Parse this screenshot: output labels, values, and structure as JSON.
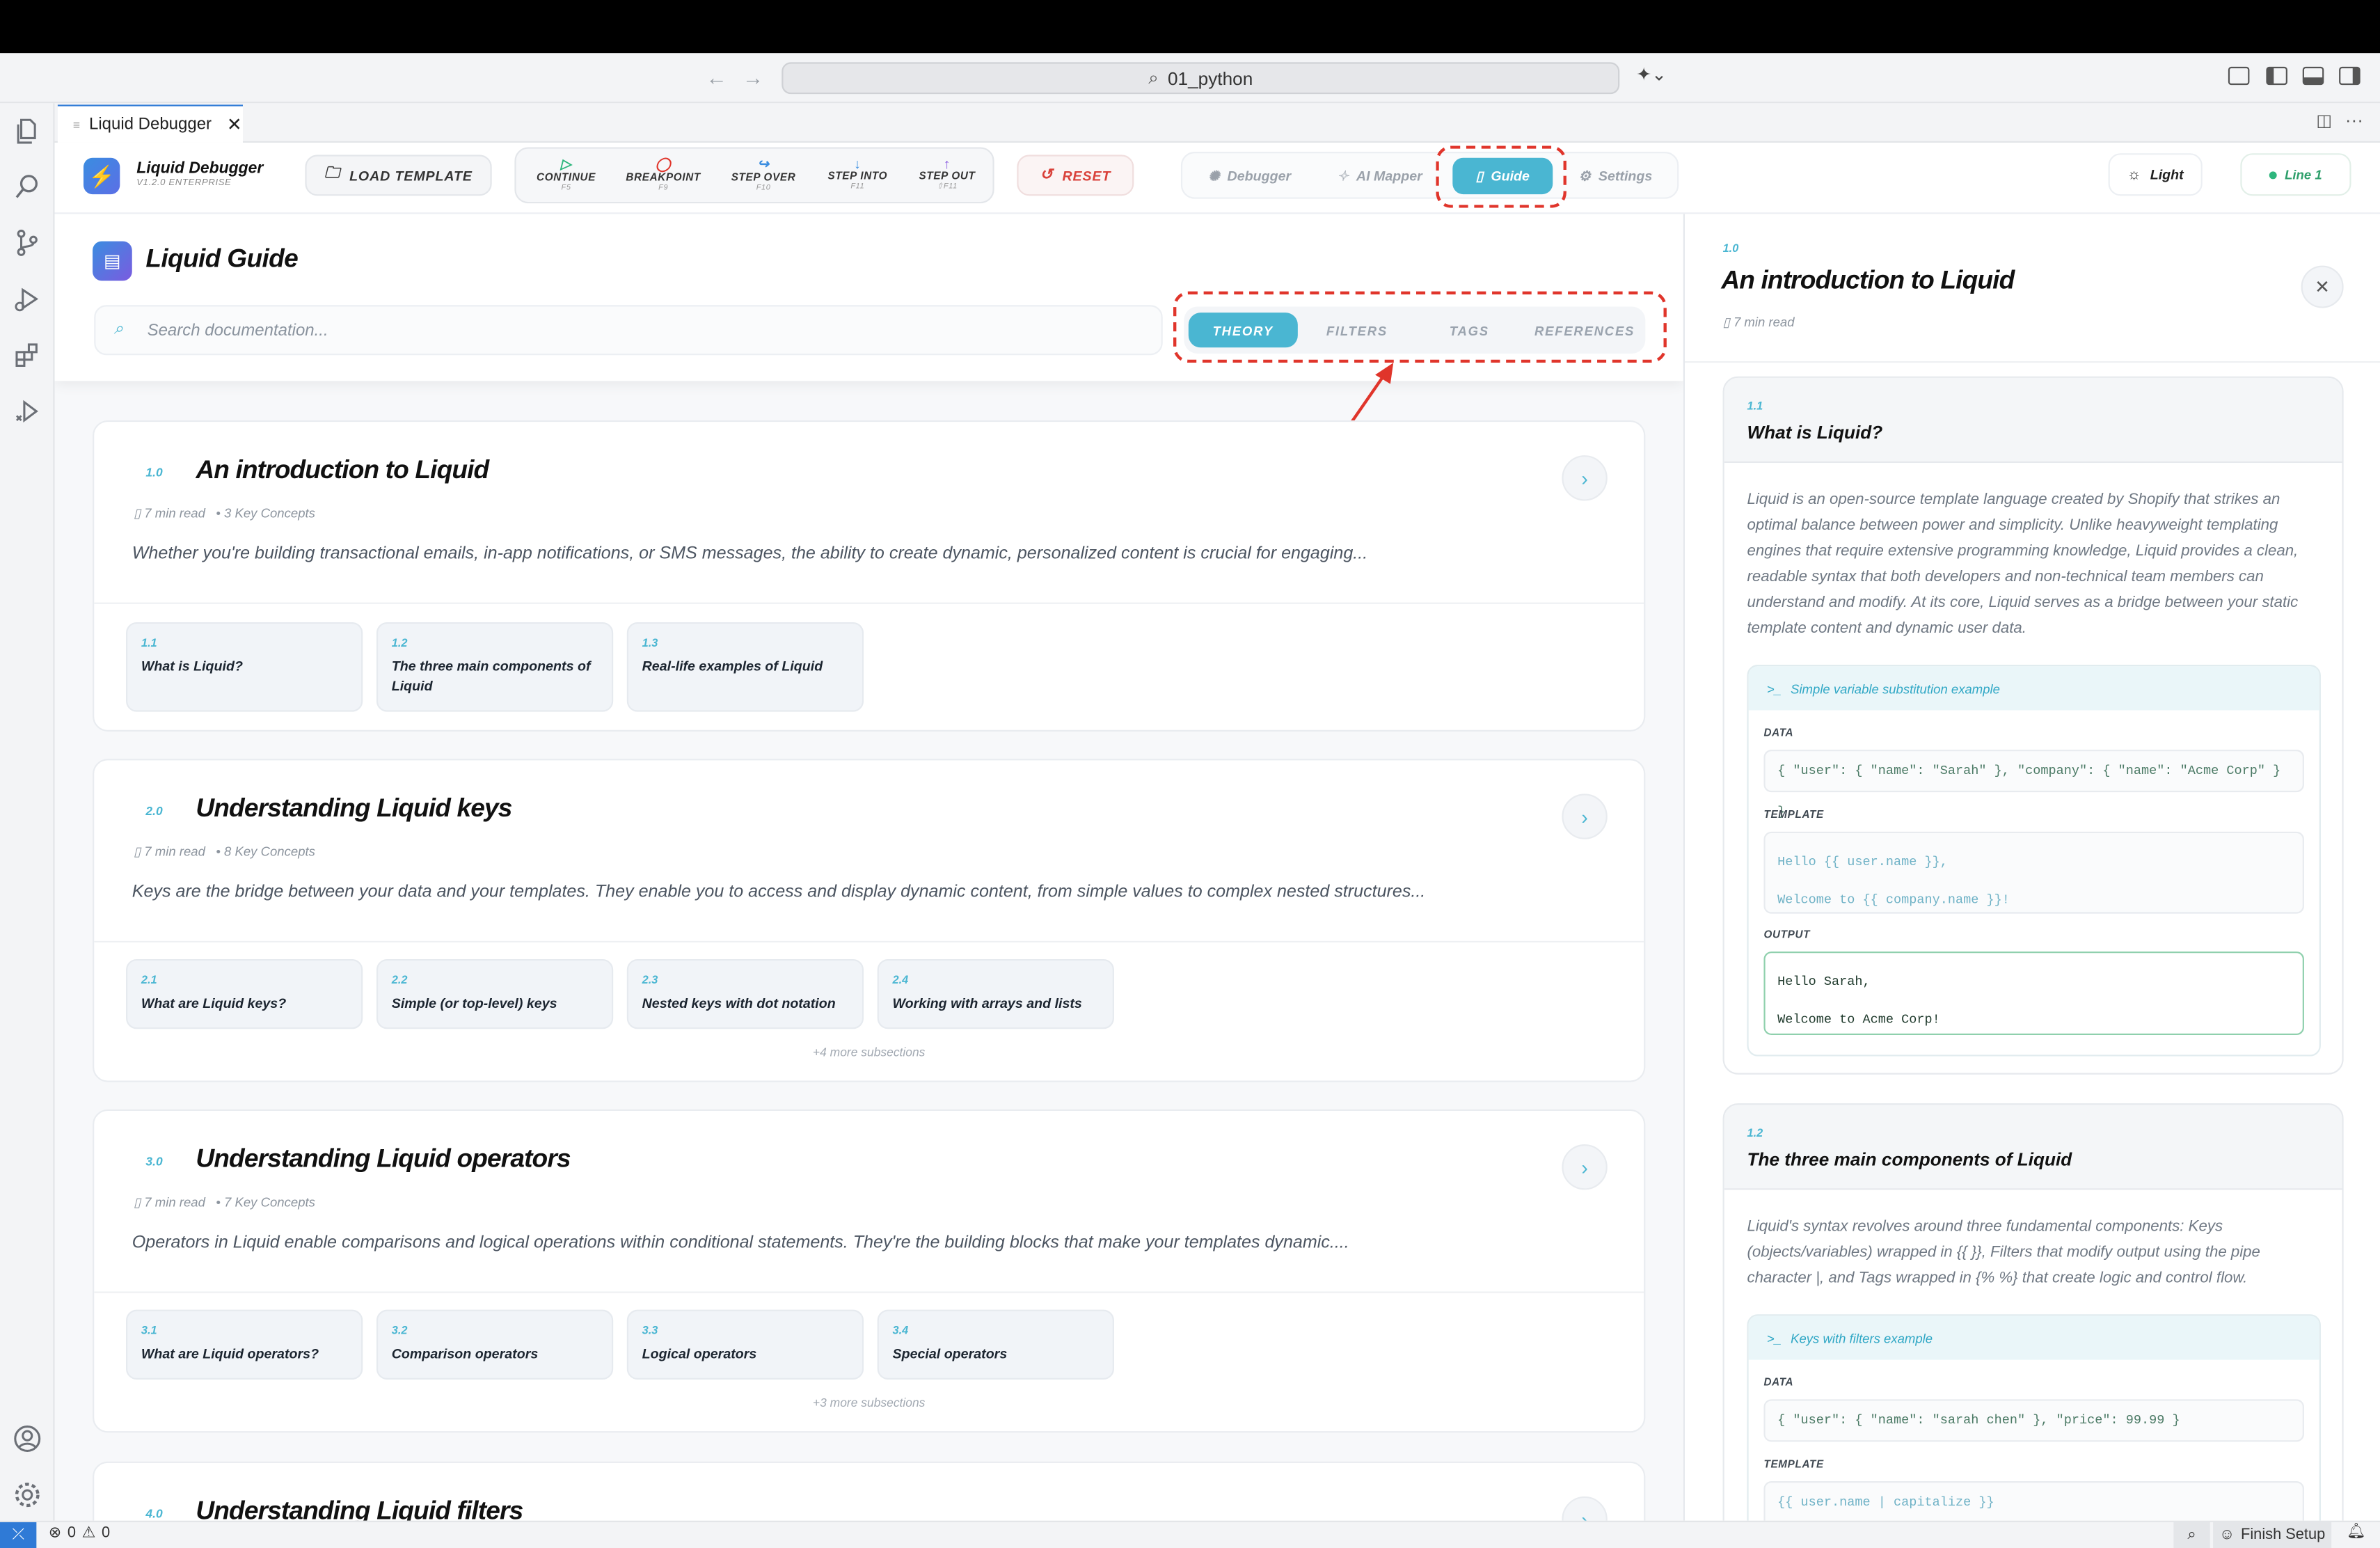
{
  "window": {
    "path": "01_python",
    "tab_title": "Liquid Debugger"
  },
  "app": {
    "name": "Liquid Debugger",
    "version": "V1.2.0 ENTERPRISE",
    "load_template": "LOAD TEMPLATE",
    "debug_buttons": [
      {
        "label": "CONTINUE",
        "key": "F5"
      },
      {
        "label": "BREAKPOINT",
        "key": "F9"
      },
      {
        "label": "STEP OVER",
        "key": "F10"
      },
      {
        "label": "STEP INTO",
        "key": "F11"
      },
      {
        "label": "STEP OUT",
        "key": "⇧F11"
      }
    ],
    "reset": "RESET",
    "nav": [
      "Debugger",
      "AI Mapper",
      "Guide",
      "Settings"
    ],
    "theme": "Light",
    "line": "Line 1"
  },
  "guide": {
    "title": "Liquid Guide",
    "search_placeholder": "Search documentation...",
    "tabs": [
      "THEORY",
      "FILTERS",
      "TAGS",
      "REFERENCES"
    ],
    "sections": [
      {
        "num": "1.0",
        "title": "An introduction to Liquid",
        "read": "7 min read",
        "concepts": "• 3 Key Concepts",
        "desc": "Whether you're building transactional emails, in-app notifications, or SMS messages, the ability to create dynamic, personalized content is crucial for engaging...",
        "subs": [
          {
            "num": "1.1",
            "title": "What is Liquid?"
          },
          {
            "num": "1.2",
            "title": "The three main components of Liquid"
          },
          {
            "num": "1.3",
            "title": "Real-life examples of Liquid"
          }
        ],
        "more": ""
      },
      {
        "num": "2.0",
        "title": "Understanding Liquid keys",
        "read": "7 min read",
        "concepts": "• 8 Key Concepts",
        "desc": "Keys are the bridge between your data and your templates. They enable you to access and display dynamic content, from simple values to complex nested structures...",
        "subs": [
          {
            "num": "2.1",
            "title": "What are Liquid keys?"
          },
          {
            "num": "2.2",
            "title": "Simple (or top-level) keys"
          },
          {
            "num": "2.3",
            "title": "Nested keys with dot notation"
          },
          {
            "num": "2.4",
            "title": "Working with arrays and lists"
          }
        ],
        "more": "+4 more subsections"
      },
      {
        "num": "3.0",
        "title": "Understanding Liquid operators",
        "read": "7 min read",
        "concepts": "• 7 Key Concepts",
        "desc": "Operators in Liquid enable comparisons and logical operations within conditional statements. They're the building blocks that make your templates dynamic....",
        "subs": [
          {
            "num": "3.1",
            "title": "What are Liquid operators?"
          },
          {
            "num": "3.2",
            "title": "Comparison operators"
          },
          {
            "num": "3.3",
            "title": "Logical operators"
          },
          {
            "num": "3.4",
            "title": "Special operators"
          }
        ],
        "more": "+3 more subsections"
      },
      {
        "num": "4.0",
        "title": "Understanding Liquid filters"
      }
    ]
  },
  "detail": {
    "num": "1.0",
    "title": "An introduction to Liquid",
    "read": "7 min read",
    "s1": {
      "num": "1.1",
      "title": "What is Liquid?",
      "body": "Liquid is an open-source template language created by Shopify that strikes an optimal balance between power and simplicity. Unlike heavyweight templating engines that require extensive programming knowledge, Liquid provides a clean, readable syntax that both developers and non-technical team members can understand and modify. At its core, Liquid serves as a bridge between your static template content and dynamic user data.",
      "example_title": "Simple variable substitution example",
      "data_label": "DATA",
      "data": "{ \"user\": { \"name\": \"Sarah\" }, \"company\": { \"name\": \"Acme Corp\" } }",
      "template_label": "TEMPLATE",
      "template_l1": "Hello {{ user.name }},",
      "template_l2": "Welcome to {{ company.name }}!",
      "output_label": "OUTPUT",
      "output_l1": "Hello Sarah,",
      "output_l2": "Welcome to Acme Corp!"
    },
    "s2": {
      "num": "1.2",
      "title": "The three main components of Liquid",
      "body": "Liquid's syntax revolves around three fundamental components: Keys (objects/variables) wrapped in {{ }}, Filters that modify output using the pipe character |, and Tags wrapped in {% %} that create logic and control flow.",
      "example_title": "Keys with filters example",
      "data_label": "DATA",
      "data": "{ \"user\": { \"name\": \"sarah chen\" }, \"price\": 99.99 }",
      "template_label": "TEMPLATE",
      "template_l1": "{{ user.name | capitalize }}"
    }
  },
  "status": {
    "errors": "0",
    "warnings": "0",
    "finish": "Finish Setup"
  },
  "colors": {
    "accent": "#4ab6d2",
    "annotation": "#e0352b",
    "reset": "#d9413a"
  }
}
